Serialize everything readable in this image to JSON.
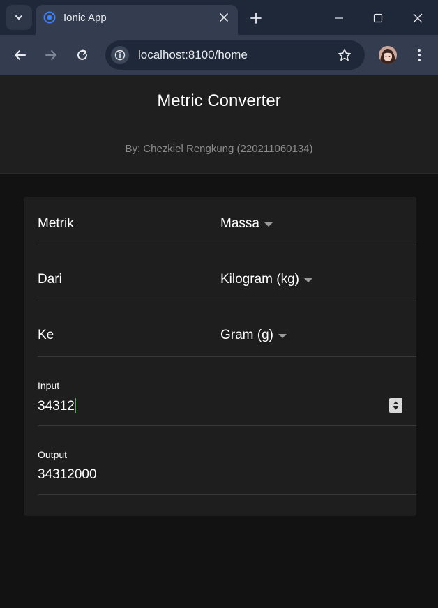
{
  "browser": {
    "tab_title": "Ionic App",
    "url": "localhost:8100/home",
    "icons": {
      "tab_menu": "chevron-down-icon",
      "favicon": "ionic-logo-icon",
      "tab_close": "close-icon",
      "new_tab": "plus-icon",
      "minimize": "minimize-icon",
      "maximize": "maximize-icon",
      "close_window": "close-icon",
      "back": "arrow-left-icon",
      "forward": "arrow-right-icon",
      "reload": "reload-icon",
      "site_info": "info-icon",
      "bookmark": "star-icon",
      "profile": "avatar",
      "menu": "kebab-menu-icon"
    }
  },
  "header": {
    "title": "Metric Converter",
    "subtitle": "By: Chezkiel Rengkung (220211060134)"
  },
  "form": {
    "metric": {
      "label": "Metrik",
      "value": "Massa"
    },
    "from": {
      "label": "Dari",
      "value": "Kilogram (kg)"
    },
    "to": {
      "label": "Ke",
      "value": "Gram (g)"
    },
    "input": {
      "label": "Input",
      "value": "34312"
    },
    "output": {
      "label": "Output",
      "value": "34312000"
    }
  },
  "colors": {
    "chrome_dark": "#1f2838",
    "chrome_light": "#333d4f",
    "page_bg": "#121212",
    "header_bg": "#1f1f1f",
    "card_bg": "#1e1e1e",
    "subtitle": "#8a8a8a",
    "ionic_blue": "#3880ff",
    "cursor": "#4caf50"
  }
}
